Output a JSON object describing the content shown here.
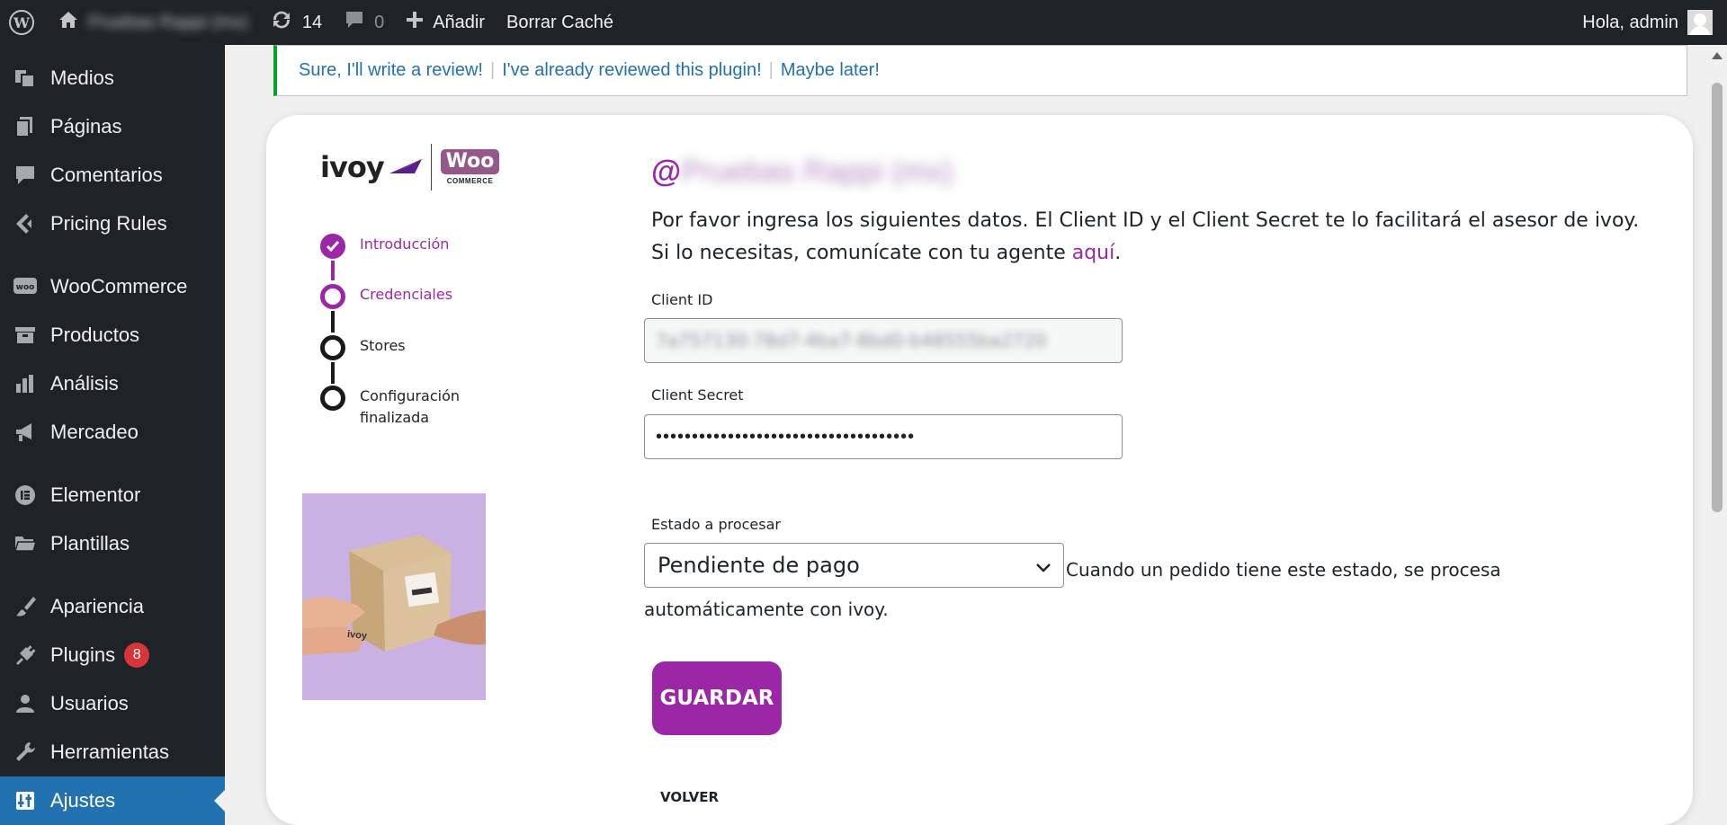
{
  "adminbar": {
    "site_name": "Pruebas Rappi (mx)",
    "updates_count": "14",
    "comments_count": "0",
    "add_new": "Añadir",
    "clear_cache": "Borrar Caché",
    "greeting": "Hola, admin"
  },
  "sidebar": {
    "items": [
      {
        "label": "Medios",
        "icon": "media-icon"
      },
      {
        "label": "Páginas",
        "icon": "pages-icon"
      },
      {
        "label": "Comentarios",
        "icon": "comments-icon"
      },
      {
        "label": "Pricing Rules",
        "icon": "pricing-rules-icon"
      },
      {
        "label": "WooCommerce",
        "icon": "woocommerce-icon"
      },
      {
        "label": "Productos",
        "icon": "products-icon"
      },
      {
        "label": "Análisis",
        "icon": "analytics-icon"
      },
      {
        "label": "Mercadeo",
        "icon": "megaphone-icon"
      },
      {
        "label": "Elementor",
        "icon": "elementor-icon"
      },
      {
        "label": "Plantillas",
        "icon": "folder-icon"
      },
      {
        "label": "Apariencia",
        "icon": "brush-icon"
      },
      {
        "label": "Plugins",
        "icon": "plugin-icon",
        "badge": "8"
      },
      {
        "label": "Usuarios",
        "icon": "users-icon"
      },
      {
        "label": "Herramientas",
        "icon": "wrench-icon"
      },
      {
        "label": "Ajustes",
        "icon": "settings-icon",
        "current": true
      }
    ]
  },
  "notice": {
    "link1": "Sure, I'll write a review!",
    "link2": "I've already reviewed this plugin!",
    "link3": "Maybe later!",
    "separator": "|"
  },
  "logo": {
    "brand": "ivoy",
    "woo": "Woo",
    "woo_sub": "COMMERCE"
  },
  "steps": [
    {
      "label": "Introducción",
      "state": "done"
    },
    {
      "label": "Credenciales",
      "state": "active"
    },
    {
      "label": "Stores",
      "state": "pending"
    },
    {
      "label": "Configuración finalizada",
      "state": "pending"
    }
  ],
  "illustration": {
    "box_brand": "ivoy"
  },
  "form": {
    "handle_prefix": "@",
    "handle_name": "Pruebas Rappi (mx)",
    "intro_text": "Por favor ingresa los siguientes datos. El Client ID y el Client Secret te lo facilitará el asesor de ivoy. Si lo necesitas, comunícate con tu agente ",
    "intro_link": "aquí",
    "intro_end": ".",
    "client_id_label": "Client ID",
    "client_id_value": "7a757130-78d7-4ba7-8bd0-b48555ba2720",
    "client_secret_label": "Client Secret",
    "client_secret_value": "••••••••••••••••••••••••••••••••••••",
    "estado_label": "Estado a procesar",
    "estado_value": "Pendiente de pago",
    "estado_help": "Cuando un pedido tiene este estado, se procesa automáticamente con ivoy.",
    "save_button": "GUARDAR",
    "back_link": "VOLVER"
  },
  "colors": {
    "brand_purple": "#9c27a6",
    "wp_admin_dark": "#1d2327",
    "wp_blue": "#2271b1",
    "notice_green": "#00a32a",
    "badge_red": "#d63638"
  }
}
